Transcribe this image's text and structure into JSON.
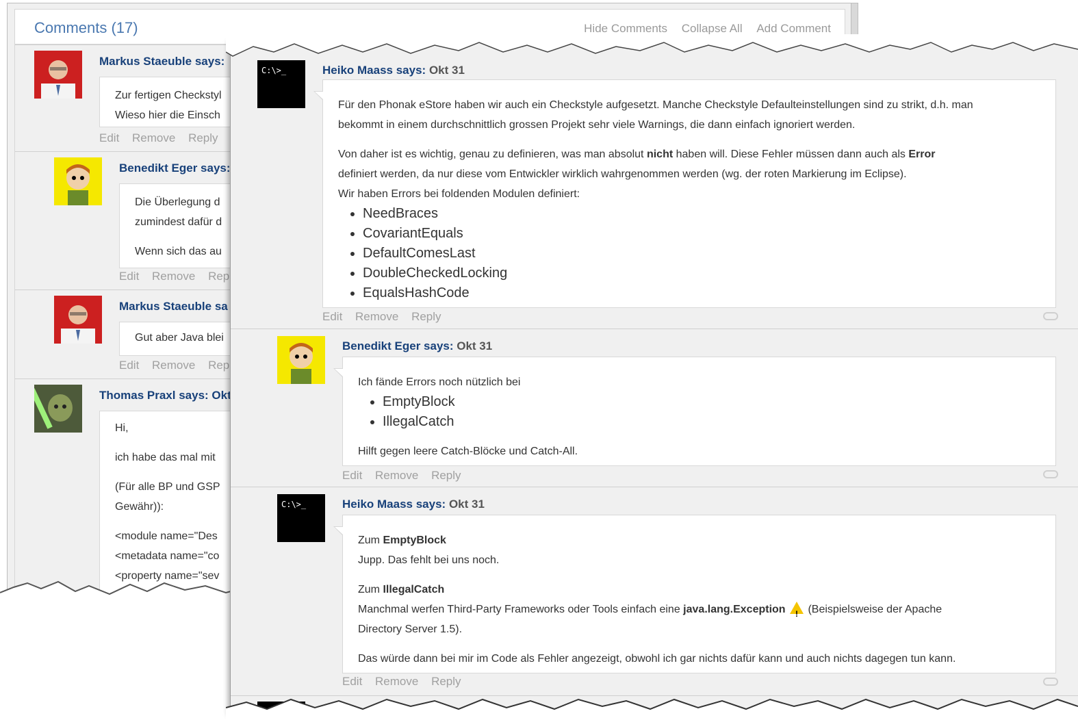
{
  "header": {
    "title": "Comments (17)",
    "actions": [
      "Hide Comments",
      "Collapse All",
      "Add Comment"
    ]
  },
  "ops": [
    "Edit",
    "Remove",
    "Reply"
  ],
  "back_comments": [
    {
      "name": "Markus Staeuble says:",
      "lines": [
        "Zur fertigen Checkstyl",
        "Wieso hier die Einsch"
      ]
    },
    {
      "name": "Benedikt Eger says:",
      "lines": [
        "Die Überlegung d",
        "zumindest dafür d",
        "Wenn sich das au"
      ]
    },
    {
      "name": "Markus Staeuble sa",
      "lines": [
        "Gut aber Java blei"
      ]
    },
    {
      "name": "Thomas Praxl says: Okt",
      "lines": [
        "Hi,",
        "ich habe das mal mit",
        "(Für alle BP und GSP",
        "Gewähr)):",
        "<module name=\"Des",
        "<metadata name=\"co",
        "<property name=\"sev"
      ]
    }
  ],
  "front_comments": [
    {
      "name": "Heiko Maass says:",
      "date": "Okt 31",
      "p1a": "Für den Phonak eStore haben wir auch ein Checkstyle aufgesetzt. Manche Checkstyle Defaulteinstellungen sind zu strikt, d.h. man",
      "p1b": "bekommt in einem durchschnittlich grossen Projekt sehr viele Warnings, die dann einfach ignoriert werden.",
      "p2a_pre": "Von daher ist es wichtig, genau zu definieren, was man absolut",
      "p2a_b1": "nicht",
      "p2a_mid": "haben will. Diese Fehler müssen dann auch als",
      "p2a_b2": "Error",
      "p2b": "definiert werden, da nur diese vom Entwickler wirklich wahrgenommen werden (wg. der roten Markierung im Eclipse).",
      "p2c": "Wir haben Errors bei foldenden Modulen definiert:",
      "items": [
        "NeedBraces",
        "CovariantEquals",
        "DefaultComesLast",
        "DoubleCheckedLocking",
        "EqualsHashCode"
      ]
    },
    {
      "name": "Benedikt Eger says:",
      "date": "Okt 31",
      "intro": "Ich fände Errors noch nützlich bei",
      "items": [
        "EmptyBlock",
        "IllegalCatch"
      ],
      "outro": "Hilft gegen leere Catch-Blöcke und Catch-All."
    },
    {
      "name": "Heiko Maass says:",
      "date": "Okt 31",
      "h1_pre": "Zum",
      "h1_b": "EmptyBlock",
      "l1": "Jupp. Das fehlt bei uns noch.",
      "h2_pre": "Zum",
      "h2_b": "IllegalCatch",
      "l2_pre": "Manchmal werfen Third-Party Frameworks oder Tools einfach eine",
      "l2_b": "java.lang.Exception",
      "l2_post": "(Beispielsweise der Apache",
      "l3": "Directory Server 1.5).",
      "l4": "Das würde dann bei mir im Code als Fehler angezeigt, obwohl ich gar nichts dafür kann und auch nichts dagegen tun kann."
    }
  ],
  "console_avatar_text": "C:\\>_"
}
